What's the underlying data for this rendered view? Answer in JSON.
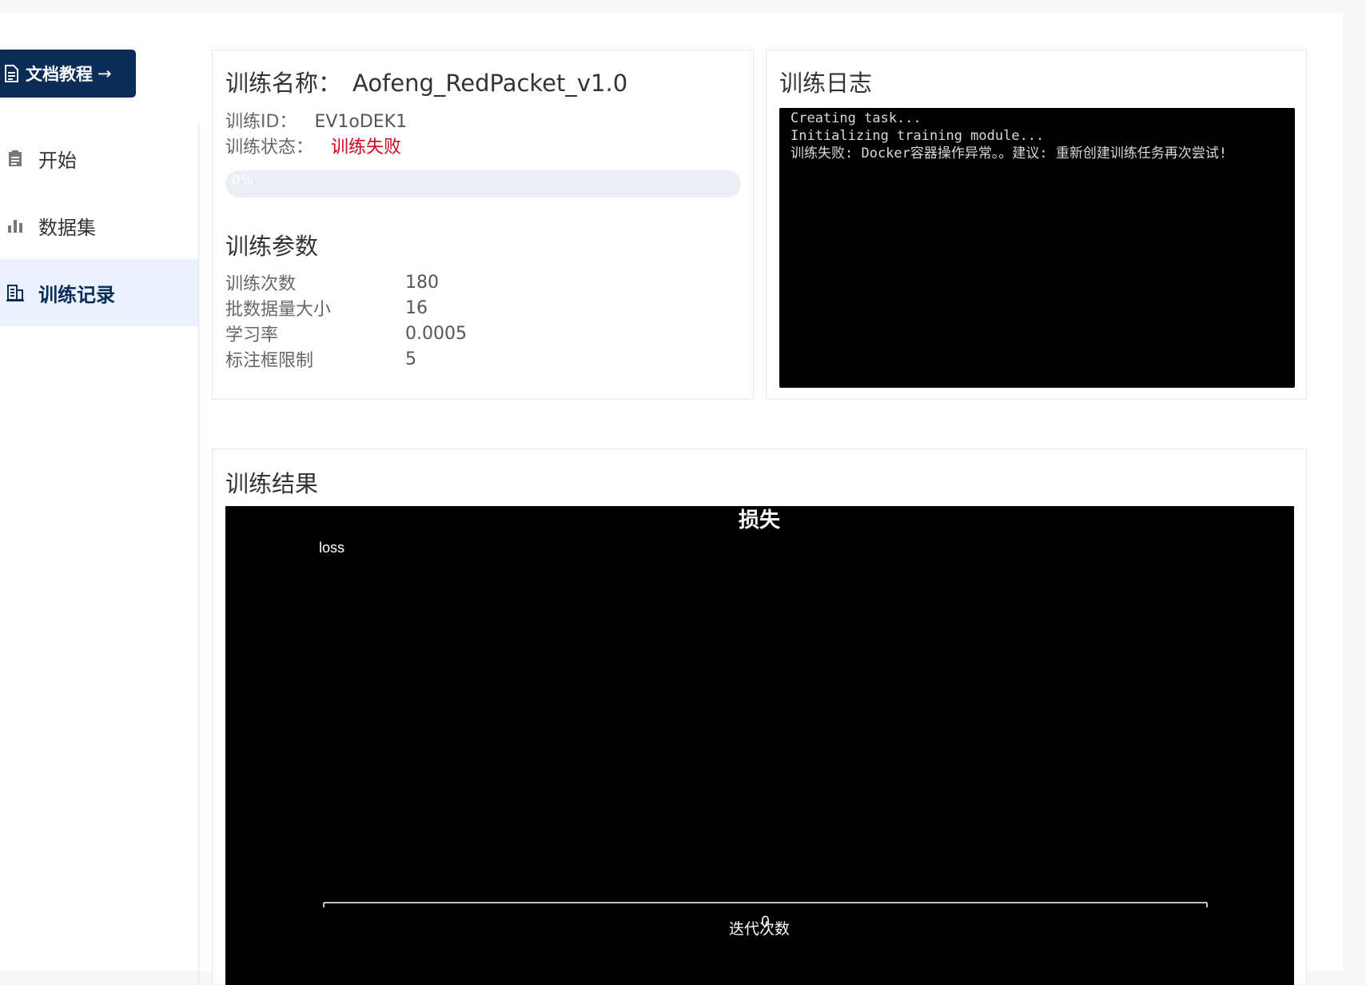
{
  "sidebar": {
    "docs_button": {
      "label": "文档教程",
      "arrow": "→",
      "icon": "document-icon"
    },
    "items": [
      {
        "label": "开始",
        "icon": "clipboard-icon",
        "active": false
      },
      {
        "label": "数据集",
        "icon": "bar-chart-icon",
        "active": false
      },
      {
        "label": "训练记录",
        "icon": "building-icon",
        "active": true
      }
    ]
  },
  "training": {
    "name_label": "训练名称：",
    "name": "Aofeng_RedPacket_v1.0",
    "id_label": "训练ID：",
    "id": "EV1oDEK1",
    "status_label": "训练状态：",
    "status": "训练失败",
    "status_color": "#d0021b",
    "progress": 0,
    "progress_text": "0%"
  },
  "params": {
    "title": "训练参数",
    "rows": [
      {
        "key": "训练次数",
        "value": "180"
      },
      {
        "key": "批数据量大小",
        "value": "16"
      },
      {
        "key": "学习率",
        "value": "0.0005"
      },
      {
        "key": "标注框限制",
        "value": "5"
      }
    ]
  },
  "log": {
    "title": "训练日志",
    "lines": [
      "Creating task...",
      "Initializing training module...",
      "训练失败: Docker容器操作异常。。建议: 重新创建训练任务再次尝试!"
    ]
  },
  "result": {
    "title": "训练结果"
  },
  "chart_data": {
    "type": "line",
    "title": "损失",
    "xlabel": "迭代次数",
    "ylabel": "",
    "series": [
      {
        "name": "loss",
        "values": []
      }
    ],
    "x": [],
    "x_ticks": [
      "0"
    ],
    "background": "#000000",
    "axis_color": "#ffffff",
    "legend_placement": "top-left",
    "grid": false
  }
}
